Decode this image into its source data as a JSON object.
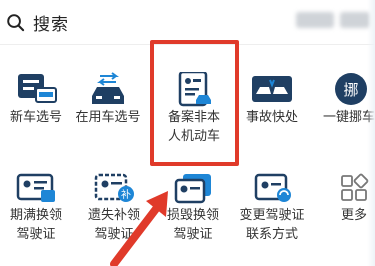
{
  "search": {
    "label": "搜索",
    "icon": "search-icon"
  },
  "colors": {
    "accent": "#1e86d6",
    "dark": "#1f3f63",
    "highlight": "#e03a2a"
  },
  "services": [
    {
      "label_line1": "新车选号",
      "label_line2": "",
      "icon": "new-car-icon"
    },
    {
      "label_line1": "在用车选号",
      "label_line2": "",
      "icon": "car-in-use-icon"
    },
    {
      "label_line1": "备案非本",
      "label_line2": "人机动车",
      "icon": "registration-doc-icon"
    },
    {
      "label_line1": "事故快处",
      "label_line2": "",
      "icon": "accident-icon"
    },
    {
      "label_line1": "一键挪车",
      "label_line2": "",
      "icon": "move-car-icon"
    },
    {
      "label_line1": "期满换领",
      "label_line2": "驾驶证",
      "icon": "license-renew-icon"
    },
    {
      "label_line1": "遗失补领",
      "label_line2": "驾驶证",
      "icon": "license-lost-icon"
    },
    {
      "label_line1": "损毁换领",
      "label_line2": "驾驶证",
      "icon": "license-damaged-icon"
    },
    {
      "label_line1": "变更驾驶证",
      "label_line2": "联系方式",
      "icon": "license-contact-icon"
    },
    {
      "label_line1": "更多",
      "label_line2": "",
      "icon": "more-grid-icon"
    }
  ]
}
